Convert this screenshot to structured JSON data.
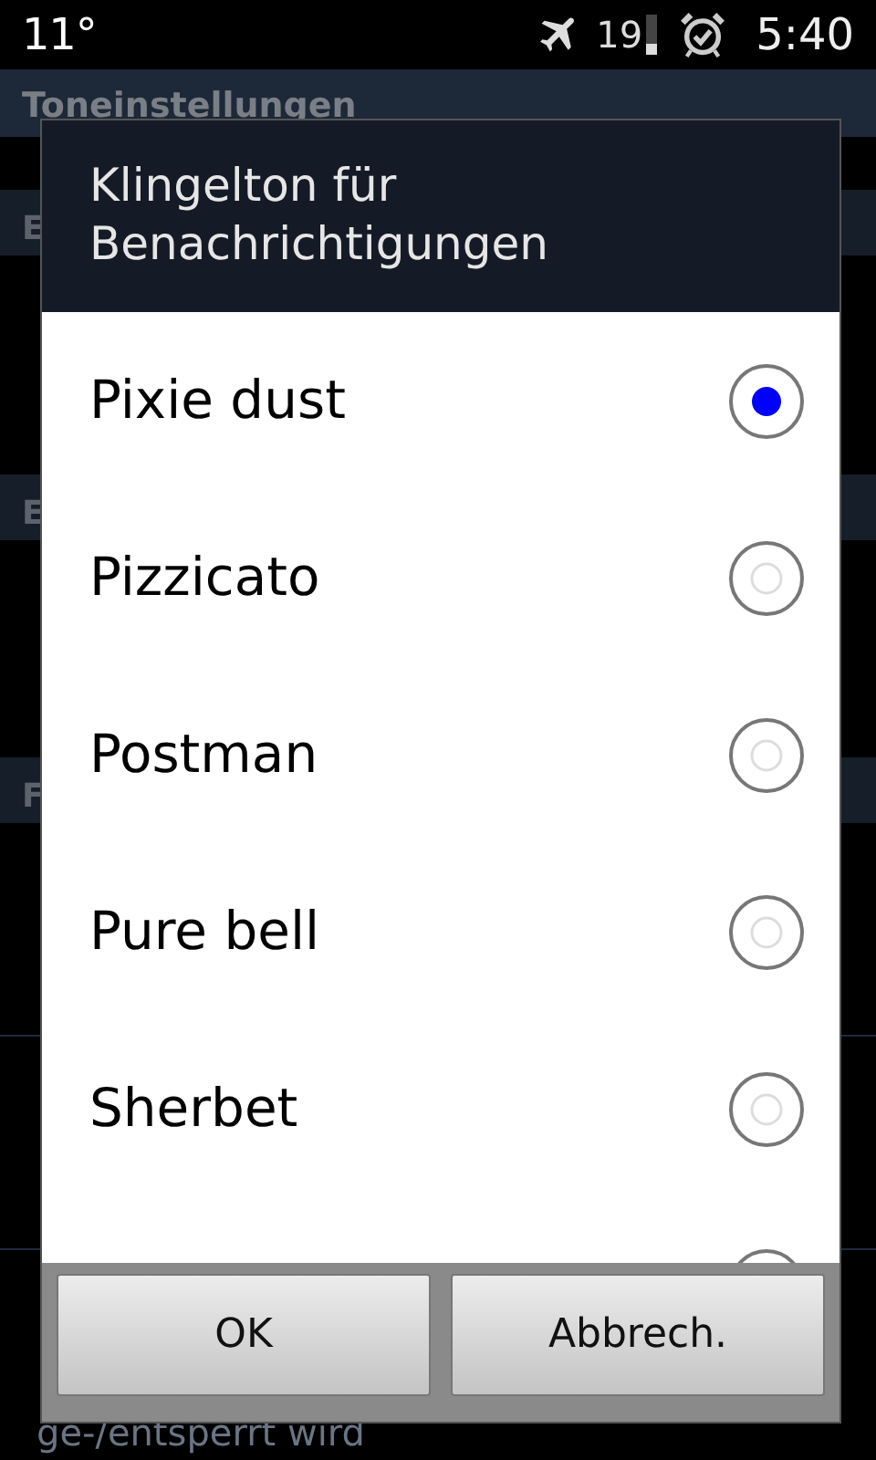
{
  "status_bar": {
    "temperature": "11°",
    "airplane_mode": true,
    "battery": "19",
    "alarm": true,
    "time": "5:40"
  },
  "screen": {
    "title": "Toneinstellungen",
    "section_headers": [
      "E",
      "E",
      "F"
    ],
    "bottom_text": "ge-/entsperrt wird"
  },
  "dialog": {
    "title": "Klingelton für Benachrichtigungen",
    "options": [
      {
        "label": "Pixie dust",
        "selected": true
      },
      {
        "label": "Pizzicato",
        "selected": false
      },
      {
        "label": "Postman",
        "selected": false
      },
      {
        "label": "Pure bell",
        "selected": false
      },
      {
        "label": "Sherbet",
        "selected": false
      }
    ],
    "buttons": [
      "OK",
      "Abbrech."
    ]
  }
}
